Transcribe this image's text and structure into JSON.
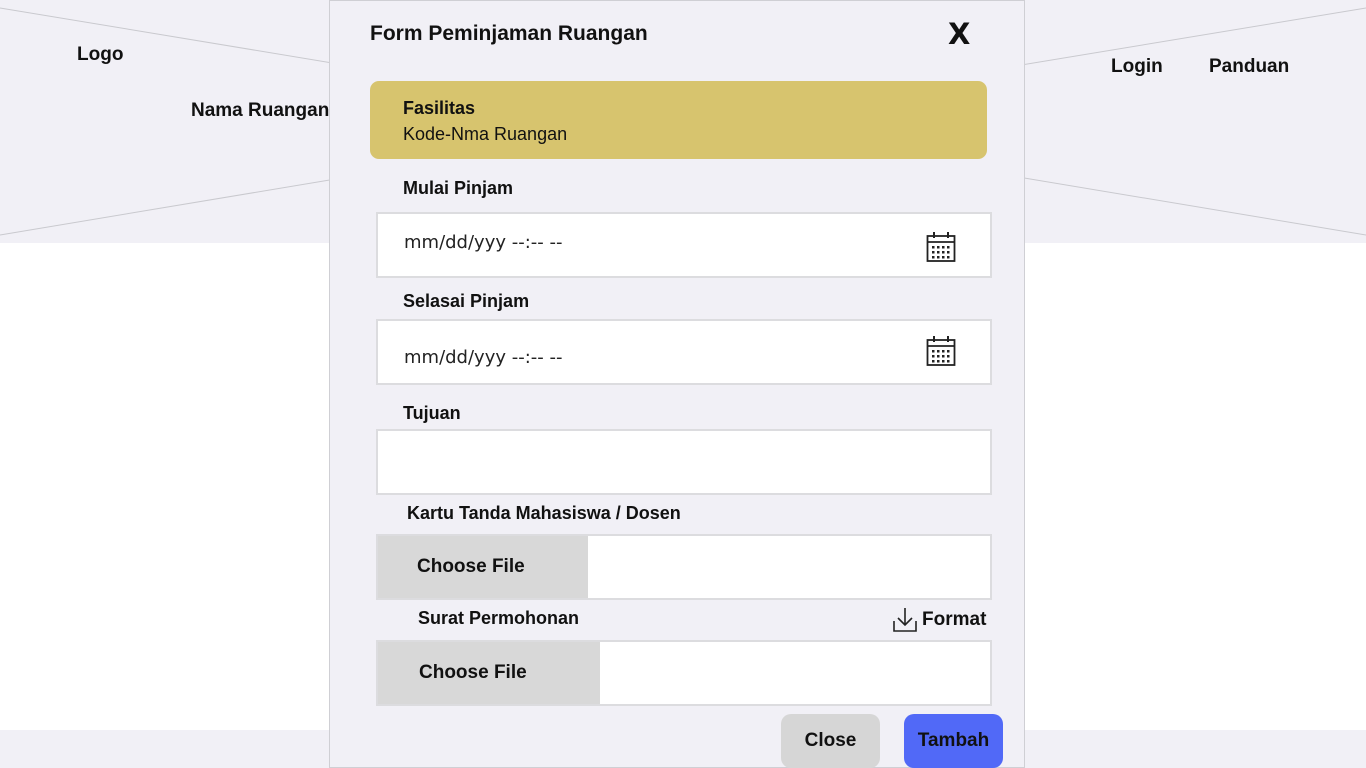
{
  "background": {
    "logo": "Logo",
    "room_name": "Nama Ruangan",
    "nav": {
      "login": "Login",
      "guide": "Panduan"
    }
  },
  "modal": {
    "title": "Form Peminjaman Ruangan",
    "close_symbol": "X",
    "facility": {
      "title": "Fasilitas",
      "code": "Kode-Nma Ruangan"
    },
    "start": {
      "label": "Mulai Pinjam",
      "placeholder": "mm/dd/yyy --:-- --",
      "icon": "calendar-icon"
    },
    "end": {
      "label": "Selasai Pinjam",
      "placeholder": "mm/dd/yyy --:-- --",
      "icon": "calendar-icon"
    },
    "purpose": {
      "label": "Tujuan",
      "value": ""
    },
    "id_card": {
      "label": "Kartu Tanda Mahasiswa / Dosen",
      "button": "Choose File"
    },
    "letter": {
      "label": "Surat Permohonan",
      "button": "Choose File",
      "format_link": "Format",
      "format_icon": "download-icon"
    },
    "buttons": {
      "close": "Close",
      "add": "Tambah"
    },
    "colors": {
      "facility_card": "#d7c46e",
      "add_button": "#5169f7",
      "close_button": "#d6d6d6",
      "modal_bg": "#f1f0f6"
    }
  }
}
